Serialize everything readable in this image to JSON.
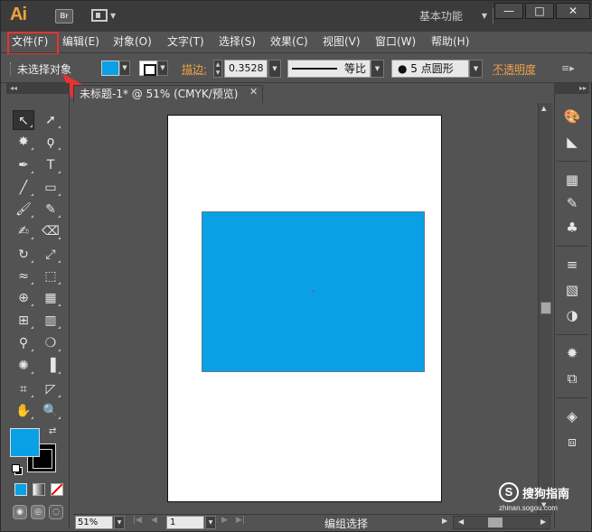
{
  "app": {
    "logo": "Ai",
    "bridge": "Br",
    "workspace": "基本功能",
    "window_buttons": [
      "—",
      "□",
      "✕"
    ]
  },
  "menu": {
    "items": [
      "文件(F)",
      "编辑(E)",
      "对象(O)",
      "文字(T)",
      "选择(S)",
      "效果(C)",
      "视图(V)",
      "窗口(W)",
      "帮助(H)"
    ]
  },
  "control": {
    "status": "未选择对象",
    "fill_color": "#0aa0e5",
    "stroke_label": "描边:",
    "stroke_weight": "0.3528",
    "profile_label": "等比",
    "brush_label": "● 5 点圆形",
    "opacity_label": "不透明度"
  },
  "document": {
    "tab_title": "未标题-1* @ 51% (CMYK/预览)",
    "close": "✕",
    "shape_color": "#0aa0e5"
  },
  "status": {
    "zoom": "51%",
    "page": "1",
    "tool_text": "编组选择"
  },
  "watermark": {
    "logo": "S",
    "text": "搜狗指南",
    "url": "zhinan.sogou.com"
  },
  "annotation": {
    "highlight_color": "#e8322e"
  }
}
